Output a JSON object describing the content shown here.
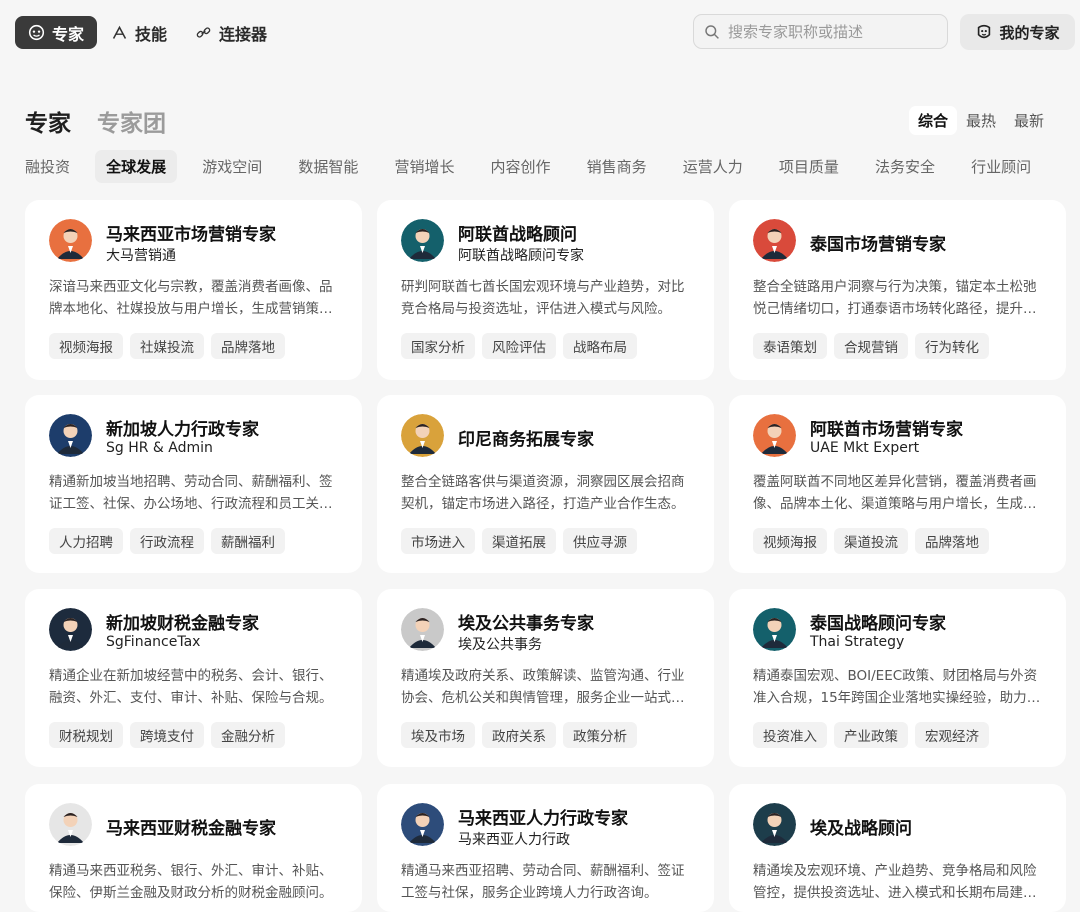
{
  "nav": {
    "experts_label": "专家",
    "skills_label": "技能",
    "connectors_label": "连接器",
    "search_placeholder": "搜索专家职称或描述",
    "my_experts_label": "我的专家"
  },
  "header": {
    "title_experts": "专家",
    "title_groups": "专家团",
    "sort": [
      "综合",
      "最热",
      "最新"
    ],
    "sort_active": "综合"
  },
  "categories": [
    "融投资",
    "全球发展",
    "游戏空间",
    "数据智能",
    "营销增长",
    "内容创作",
    "销售商务",
    "运营人力",
    "项目质量",
    "法务安全",
    "行业顾问"
  ],
  "category_active": "全球发展",
  "cards": [
    {
      "name": "马来西亚市场营销专家",
      "sub": "大马营销通",
      "desc": "深谙马来西亚文化与宗教，覆盖消费者画像、品牌本地化、社媒投放与用户增长，生成营销策略。",
      "tags": [
        "视频海报",
        "社媒投流",
        "品牌落地"
      ],
      "avatar": "#e8703f"
    },
    {
      "name": "阿联酋战略顾问",
      "sub": "阿联酋战略顾问专家",
      "desc": "研判阿联酋七酋长国宏观环境与产业趋势，对比竞合格局与投资选址，评估进入模式与风险。",
      "tags": [
        "国家分析",
        "风险评估",
        "战略布局"
      ],
      "avatar": "#14606b"
    },
    {
      "name": "泰国市场营销专家",
      "sub": "",
      "desc": "整合全链路用户洞察与行为决策，锚定本土松弛悦己情绪切口，打通泰语市场转化路径，提升增长。",
      "tags": [
        "泰语策划",
        "合规营销",
        "行为转化"
      ],
      "avatar": "#d94a3b"
    },
    {
      "name": "新加坡人力行政专家",
      "sub": "Sg HR & Admin",
      "desc": "精通新加坡当地招聘、劳动合同、薪酬福利、签证工签、社保、办公场地、行政流程和员工关系。",
      "tags": [
        "人力招聘",
        "行政流程",
        "薪酬福利"
      ],
      "avatar": "#1d3d6b"
    },
    {
      "name": "印尼商务拓展专家",
      "sub": "",
      "desc": "整合全链路客供与渠道资源，洞察园区展会招商契机，锚定市场进入路径，打造产业合作生态。",
      "tags": [
        "市场进入",
        "渠道拓展",
        "供应寻源"
      ],
      "avatar": "#d9a23b"
    },
    {
      "name": "阿联酋市场营销专家",
      "sub": "UAE Mkt Expert",
      "desc": "覆盖阿联酋不同地区差异化营销，覆盖消费者画像、品牌本土化、渠道策略与用户增长，生成方案。",
      "tags": [
        "视频海报",
        "渠道投流",
        "品牌落地"
      ],
      "avatar": "#e8703f"
    },
    {
      "name": "新加坡财税金融专家",
      "sub": "SgFinanceTax",
      "desc": "精通企业在新加坡经营中的税务、会计、银行、融资、外汇、支付、审计、补贴、保险与合规。",
      "tags": [
        "财税规划",
        "跨境支付",
        "金融分析"
      ],
      "avatar": "#1d2b3d"
    },
    {
      "name": "埃及公共事务专家",
      "sub": "埃及公共事务",
      "desc": "精通埃及政府关系、政策解读、监管沟通、行业协会、危机公关和舆情管理，服务企业一站式落地。",
      "tags": [
        "埃及市场",
        "政府关系",
        "政策分析"
      ],
      "avatar": "#c9c9c9"
    },
    {
      "name": "泰国战略顾问专家",
      "sub": "Thai Strategy",
      "desc": "精通泰国宏观、BOI/EEC政策、财团格局与外资准入合规，15年跨国企业落地实操经验，助力出海。",
      "tags": [
        "投资准入",
        "产业政策",
        "宏观经济"
      ],
      "avatar": "#14606b"
    },
    {
      "name": "马来西亚财税金融专家",
      "sub": "",
      "desc": "精通马来西亚税务、银行、外汇、审计、补贴、保险、伊斯兰金融及财政分析的财税金融顾问。",
      "tags": [],
      "avatar": "#e6e6e6"
    },
    {
      "name": "马来西亚人力行政专家",
      "sub": "马来西亚人力行政",
      "desc": "精通马来西亚招聘、劳动合同、薪酬福利、签证工签与社保，服务企业跨境人力行政咨询。",
      "tags": [],
      "avatar": "#2d4c7a"
    },
    {
      "name": "埃及战略顾问",
      "sub": "",
      "desc": "精通埃及宏观环境、产业趋势、竞争格局和风险管控，提供投资选址、进入模式和长期布局建议。",
      "tags": [],
      "avatar": "#1d3d4b"
    }
  ]
}
